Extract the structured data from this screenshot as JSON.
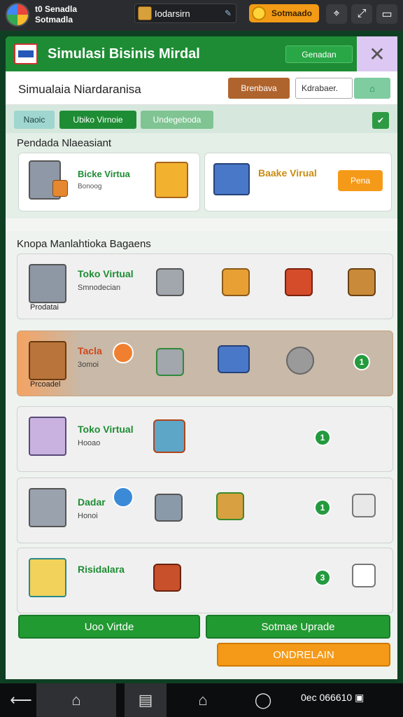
{
  "topbar": {
    "profile_line1": "t0 Senadla",
    "profile_line2": "Sotmadla",
    "center_label": "Iodarsirn",
    "coins_label": "Sotmaado"
  },
  "header": {
    "title": "Simulasi Bisinis Mirdal",
    "button_label": "Genadan"
  },
  "subheader": {
    "title": "Simualaia Niardaranisa",
    "brown_button": "Brenbava",
    "input_value": "Kdrabaer."
  },
  "tabs": [
    "Naoic",
    "Ubiko Virnoie",
    "Undegeboda"
  ],
  "section1": {
    "title": "Pendada Nlaeasiant",
    "card1": {
      "name": "Bicke Virtua",
      "sub": "Bonoog"
    },
    "card2": {
      "name": "Baake Virual",
      "button": "Pena"
    }
  },
  "section2": {
    "title": "Knopa Manlahtioka Bagaens",
    "rows": [
      {
        "name": "Toko Virtual",
        "sub": "Smnodecian",
        "tag": "Prodatai",
        "badge": ""
      },
      {
        "name": "Tacla",
        "sub": "3omoi",
        "tag": "Prcoadel",
        "badge": "1"
      },
      {
        "name": "Toko Virtual",
        "sub": "Hooao",
        "tag": "",
        "badge": "1"
      },
      {
        "name": "Dadar",
        "sub": "Honoi",
        "tag": "",
        "badge": "1"
      },
      {
        "name": "Risidalara",
        "sub": "",
        "tag": "",
        "badge": "3"
      }
    ]
  },
  "actions": {
    "left_button": "Uoo Virtde",
    "right_button": "Sotmae Uprade",
    "orange_button": "ONDRELAIN"
  },
  "navbar": {
    "status_text": "0ec 066610"
  },
  "colors": {
    "primary_green": "#1e8c34",
    "orange": "#f39b16",
    "brown": "#b0642d",
    "highlight_row": "#c8b9a8"
  }
}
